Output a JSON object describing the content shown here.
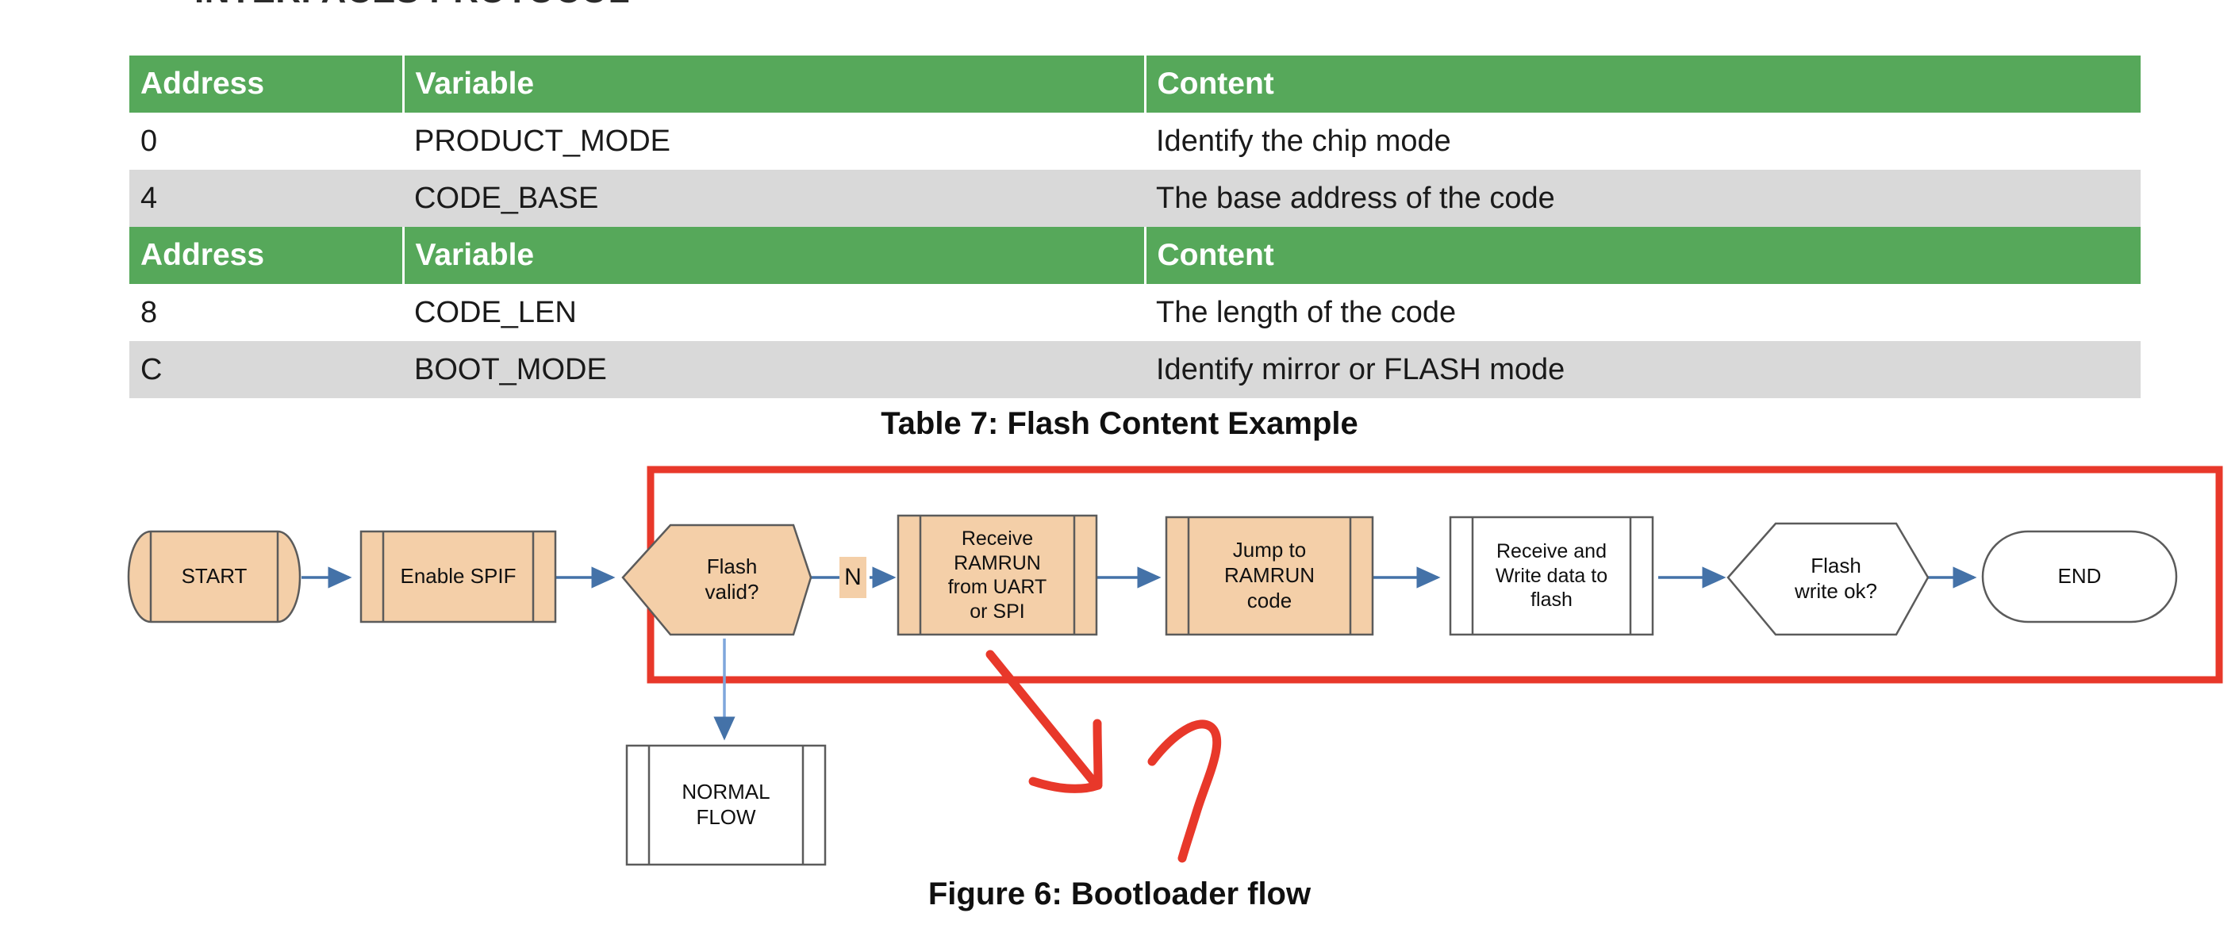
{
  "document": {
    "cut_off_heading": "INTERFACES PROTOCOL"
  },
  "table": {
    "headers": [
      "Address",
      "Variable",
      "Content"
    ],
    "header_bg": "#56A85A",
    "header_text_color": "#FFFFFF",
    "alt_row_bg": "#D9D9D9",
    "groups": [
      {
        "headers": [
          "Address",
          "Variable",
          "Content"
        ],
        "rows": [
          {
            "address": "0",
            "variable": "PRODUCT_MODE",
            "content": "Identify the chip mode",
            "shaded": false
          },
          {
            "address": "4",
            "variable": "CODE_BASE",
            "content": "The base address of the code",
            "shaded": true
          }
        ]
      },
      {
        "headers": [
          "Address",
          "Variable",
          "Content"
        ],
        "rows": [
          {
            "address": "8",
            "variable": "CODE_LEN",
            "content": "The length of the code",
            "shaded": false
          },
          {
            "address": "C",
            "variable": "BOOT_MODE",
            "content": "Identify mirror or FLASH mode",
            "shaded": true
          }
        ]
      }
    ],
    "caption": "Table 7: Flash Content Example"
  },
  "figure": {
    "caption": "Figure 6: Bootloader flow",
    "colors": {
      "node_fill_peach": "#F4CFA8",
      "node_fill_white": "#FFFFFF",
      "node_stroke": "#5B5B5B",
      "connector": "#4472A8",
      "annotation_red": "#E8382A"
    },
    "nodes": [
      {
        "id": "start",
        "label": "START",
        "shape": "cylinder-horizontal",
        "fill": "peach"
      },
      {
        "id": "enable-spif",
        "label": "Enable SPIF",
        "shape": "predefined-process",
        "fill": "peach"
      },
      {
        "id": "flash-valid",
        "label": "Flash\nvalid?",
        "shape": "hexagon",
        "fill": "peach"
      },
      {
        "id": "receive-ramrun",
        "label": "Receive\nRAMRUN\nfrom UART\nor SPI",
        "shape": "predefined-process",
        "fill": "peach"
      },
      {
        "id": "jump-ramrun",
        "label": "Jump to\nRAMRUN\ncode",
        "shape": "predefined-process",
        "fill": "peach"
      },
      {
        "id": "write-flash",
        "label": "Receive and\nWrite data to\nflash",
        "shape": "predefined-process",
        "fill": "white"
      },
      {
        "id": "flash-write-ok",
        "label": "Flash\nwrite ok?",
        "shape": "hexagon",
        "fill": "white"
      },
      {
        "id": "end",
        "label": "END",
        "shape": "stadium",
        "fill": "white"
      },
      {
        "id": "normal-flow",
        "label": "NORMAL\nFLOW",
        "shape": "predefined-process",
        "fill": "white"
      }
    ],
    "branch_labels": [
      {
        "id": "branch-n",
        "label": "N"
      }
    ],
    "annotations": {
      "highlight_rect": {
        "color": "#E8382A",
        "note": "red rectangle around main bootloader path"
      },
      "hand_arrow": {
        "color": "#E8382A",
        "note": "hand-drawn arrow pointing down-right from Receive RAMRUN box"
      },
      "question_mark": {
        "color": "#E8382A",
        "label": "?"
      }
    }
  }
}
